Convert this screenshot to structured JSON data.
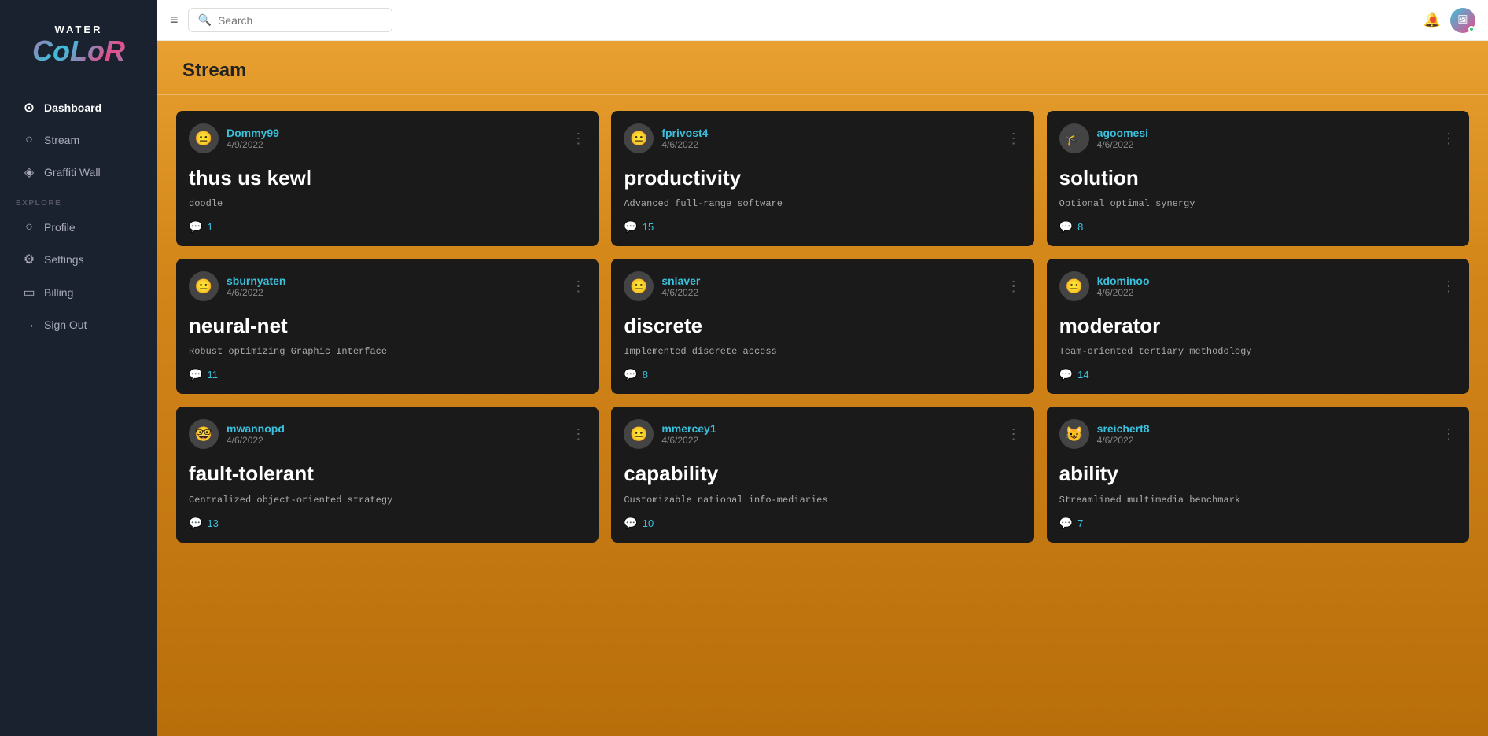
{
  "app": {
    "name_top": "WATER",
    "name_bottom": "CoLoR"
  },
  "sidebar": {
    "nav_items": [
      {
        "id": "dashboard",
        "label": "Dashboard",
        "icon": "⊙",
        "active": true
      },
      {
        "id": "stream",
        "label": "Stream",
        "icon": "○"
      },
      {
        "id": "graffiti-wall",
        "label": "Graffiti Wall",
        "icon": "◈"
      }
    ],
    "explore_label": "EXPLORE",
    "explore_items": [
      {
        "id": "profile",
        "label": "Profile",
        "icon": "○"
      },
      {
        "id": "settings",
        "label": "Settings",
        "icon": "⚙"
      },
      {
        "id": "billing",
        "label": "Billing",
        "icon": "▭"
      },
      {
        "id": "sign-out",
        "label": "Sign Out",
        "icon": "→"
      }
    ]
  },
  "topbar": {
    "search_placeholder": "Search",
    "hamburger_icon": "≡"
  },
  "content": {
    "title": "Stream",
    "cards": [
      {
        "id": "card-1",
        "username": "Dommy99",
        "date": "4/9/2022",
        "title": "thus us kewl",
        "description": "doodle",
        "comments": 1,
        "avatar": "😐"
      },
      {
        "id": "card-2",
        "username": "fprivost4",
        "date": "4/6/2022",
        "title": "productivity",
        "description": "Advanced full-range software",
        "comments": 15,
        "avatar": "😐"
      },
      {
        "id": "card-3",
        "username": "agoomesi",
        "date": "4/6/2022",
        "title": "solution",
        "description": "Optional optimal synergy",
        "comments": 8,
        "avatar": "🎓"
      },
      {
        "id": "card-4",
        "username": "sburnyaten",
        "date": "4/6/2022",
        "title": "neural-net",
        "description": "Robust optimizing Graphic Interface",
        "comments": 11,
        "avatar": "😐"
      },
      {
        "id": "card-5",
        "username": "sniaver",
        "date": "4/6/2022",
        "title": "discrete",
        "description": "Implemented discrete access",
        "comments": 8,
        "avatar": "😐"
      },
      {
        "id": "card-6",
        "username": "kdominoo",
        "date": "4/6/2022",
        "title": "moderator",
        "description": "Team-oriented tertiary methodology",
        "comments": 14,
        "avatar": "😐"
      },
      {
        "id": "card-7",
        "username": "mwannopd",
        "date": "4/6/2022",
        "title": "fault-tolerant",
        "description": "Centralized object-oriented strategy",
        "comments": 13,
        "avatar": "🤓"
      },
      {
        "id": "card-8",
        "username": "mmercey1",
        "date": "4/6/2022",
        "title": "capability",
        "description": "Customizable national info-mediaries",
        "comments": 10,
        "avatar": "😐"
      },
      {
        "id": "card-9",
        "username": "sreichert8",
        "date": "4/6/2022",
        "title": "ability",
        "description": "Streamlined multimedia benchmark",
        "comments": 7,
        "avatar": "😺"
      }
    ]
  }
}
